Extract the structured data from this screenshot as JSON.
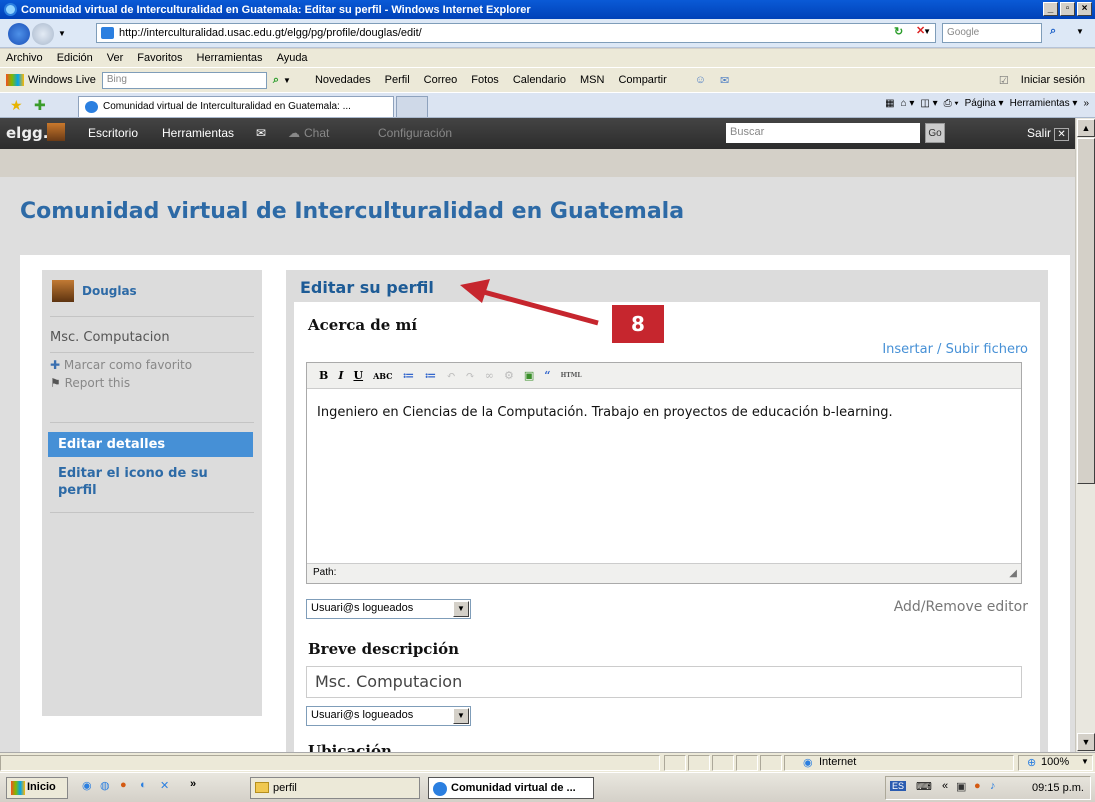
{
  "window": {
    "title": "Comunidad virtual de Interculturalidad en Guatemala: Editar su perfil - Windows Internet Explorer",
    "controls": [
      "_",
      "▫",
      "×"
    ]
  },
  "address": {
    "url": "http://interculturalidad.usac.edu.gt/elgg/pg/profile/douglas/edit/",
    "search_placeholder": "Google"
  },
  "menubar": [
    "Archivo",
    "Edición",
    "Ver",
    "Favoritos",
    "Herramientas",
    "Ayuda"
  ],
  "live_toolbar": {
    "brand": "Windows Live",
    "search_placeholder": "Bing",
    "items": [
      "Novedades",
      "Perfil",
      "Correo",
      "Fotos",
      "Calendario",
      "MSN",
      "Compartir"
    ],
    "signin": "Iniciar sesión"
  },
  "tabs": {
    "active_label": "Comunidad virtual de Interculturalidad en Guatemala: ...",
    "command_items": [
      "Página",
      "Herramientas"
    ]
  },
  "elgg_topbar": {
    "logo": "elgg.",
    "items": [
      "Escritorio",
      "Herramientas",
      "Chat",
      "Configuración"
    ],
    "search_placeholder": "Buscar",
    "go": "Go",
    "logout": "Salir"
  },
  "site": {
    "title": "Comunidad virtual de Interculturalidad en Guatemala"
  },
  "sidebar": {
    "username": "Douglas",
    "brief": "Msc. Computacion",
    "actions": [
      "Marcar como favorito",
      "Report this"
    ],
    "menu": [
      "Editar detalles",
      "Editar el icono de su perfil"
    ]
  },
  "main": {
    "title": "Editar su perfil",
    "about_label": "Acerca de mí",
    "insert_link": "Insertar / Subir fichero",
    "editor_toolbar": [
      "B",
      "I",
      "U",
      "ABC",
      "≔",
      "≔",
      "↶",
      "↷",
      "∞",
      "⚙",
      "▣",
      "“",
      "HTML"
    ],
    "editor_text": "Ingeniero en Ciencias de la Computación. Trabajo en proyectos de educación b-learning.",
    "path_label": "Path:",
    "access_1": "Usuari@s logueados",
    "add_remove": "Add/Remove editor",
    "brief_label": "Breve descripción",
    "brief_value": "Msc. Computacion",
    "access_2": "Usuari@s logueados",
    "next_label": "Ubicación"
  },
  "annotation": {
    "badge": "8",
    "color": "#c6262e"
  },
  "statusbar": {
    "zone": "Internet",
    "zoom": "100%"
  },
  "taskbar": {
    "start": "Inicio",
    "folder": "perfil",
    "ie_task": "Comunidad virtual de ...",
    "clock": "09:15 p.m."
  }
}
